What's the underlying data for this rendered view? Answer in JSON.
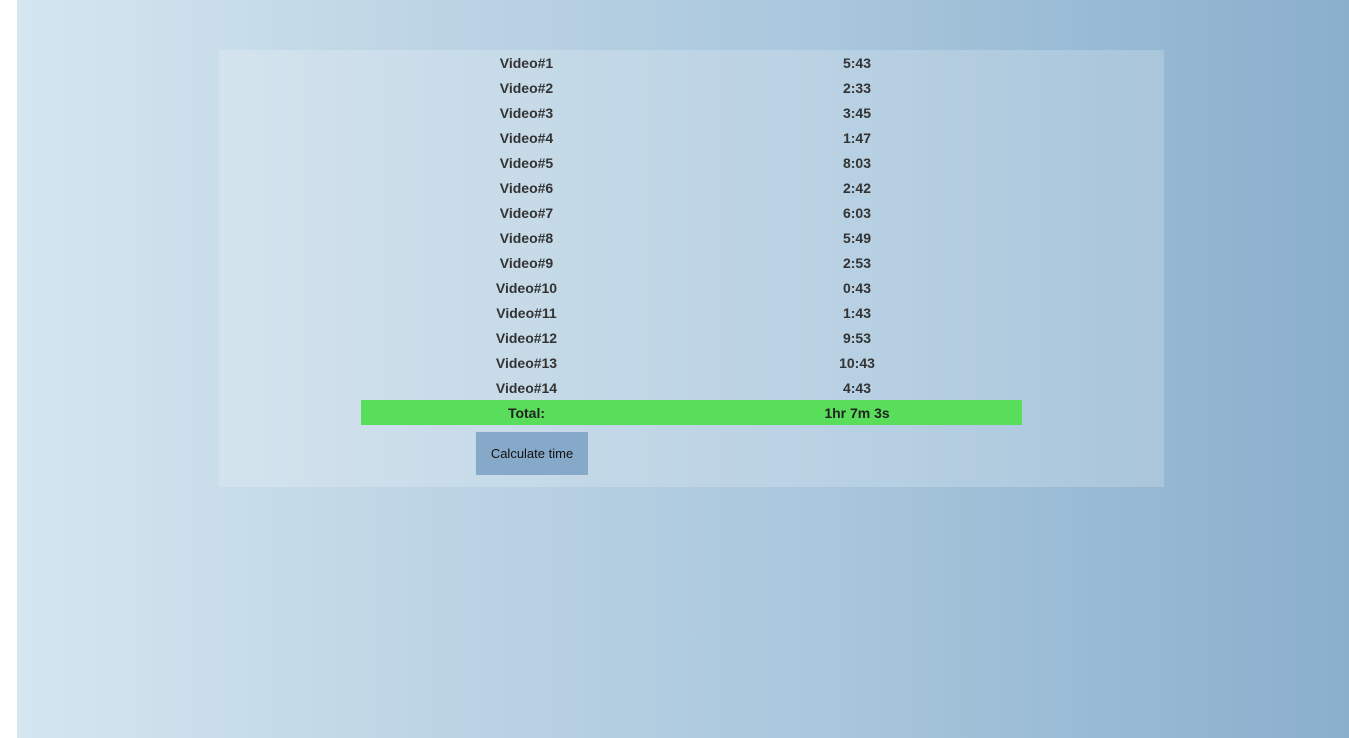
{
  "videos": [
    {
      "name": "Video#1",
      "duration": "5:43"
    },
    {
      "name": "Video#2",
      "duration": "2:33"
    },
    {
      "name": "Video#3",
      "duration": "3:45"
    },
    {
      "name": "Video#4",
      "duration": "1:47"
    },
    {
      "name": "Video#5",
      "duration": "8:03"
    },
    {
      "name": "Video#6",
      "duration": "2:42"
    },
    {
      "name": "Video#7",
      "duration": "6:03"
    },
    {
      "name": "Video#8",
      "duration": "5:49"
    },
    {
      "name": "Video#9",
      "duration": "2:53"
    },
    {
      "name": "Video#10",
      "duration": "0:43"
    },
    {
      "name": "Video#11",
      "duration": "1:43"
    },
    {
      "name": "Video#12",
      "duration": "9:53"
    },
    {
      "name": "Video#13",
      "duration": "10:43"
    },
    {
      "name": "Video#14",
      "duration": "4:43"
    }
  ],
  "total": {
    "label": "Total:",
    "value": "1hr 7m 3s"
  },
  "calculate_button": {
    "label": "Calculate time"
  },
  "colors": {
    "total_row_bg": "#59de5b",
    "button_bg": "#87a9c9"
  }
}
